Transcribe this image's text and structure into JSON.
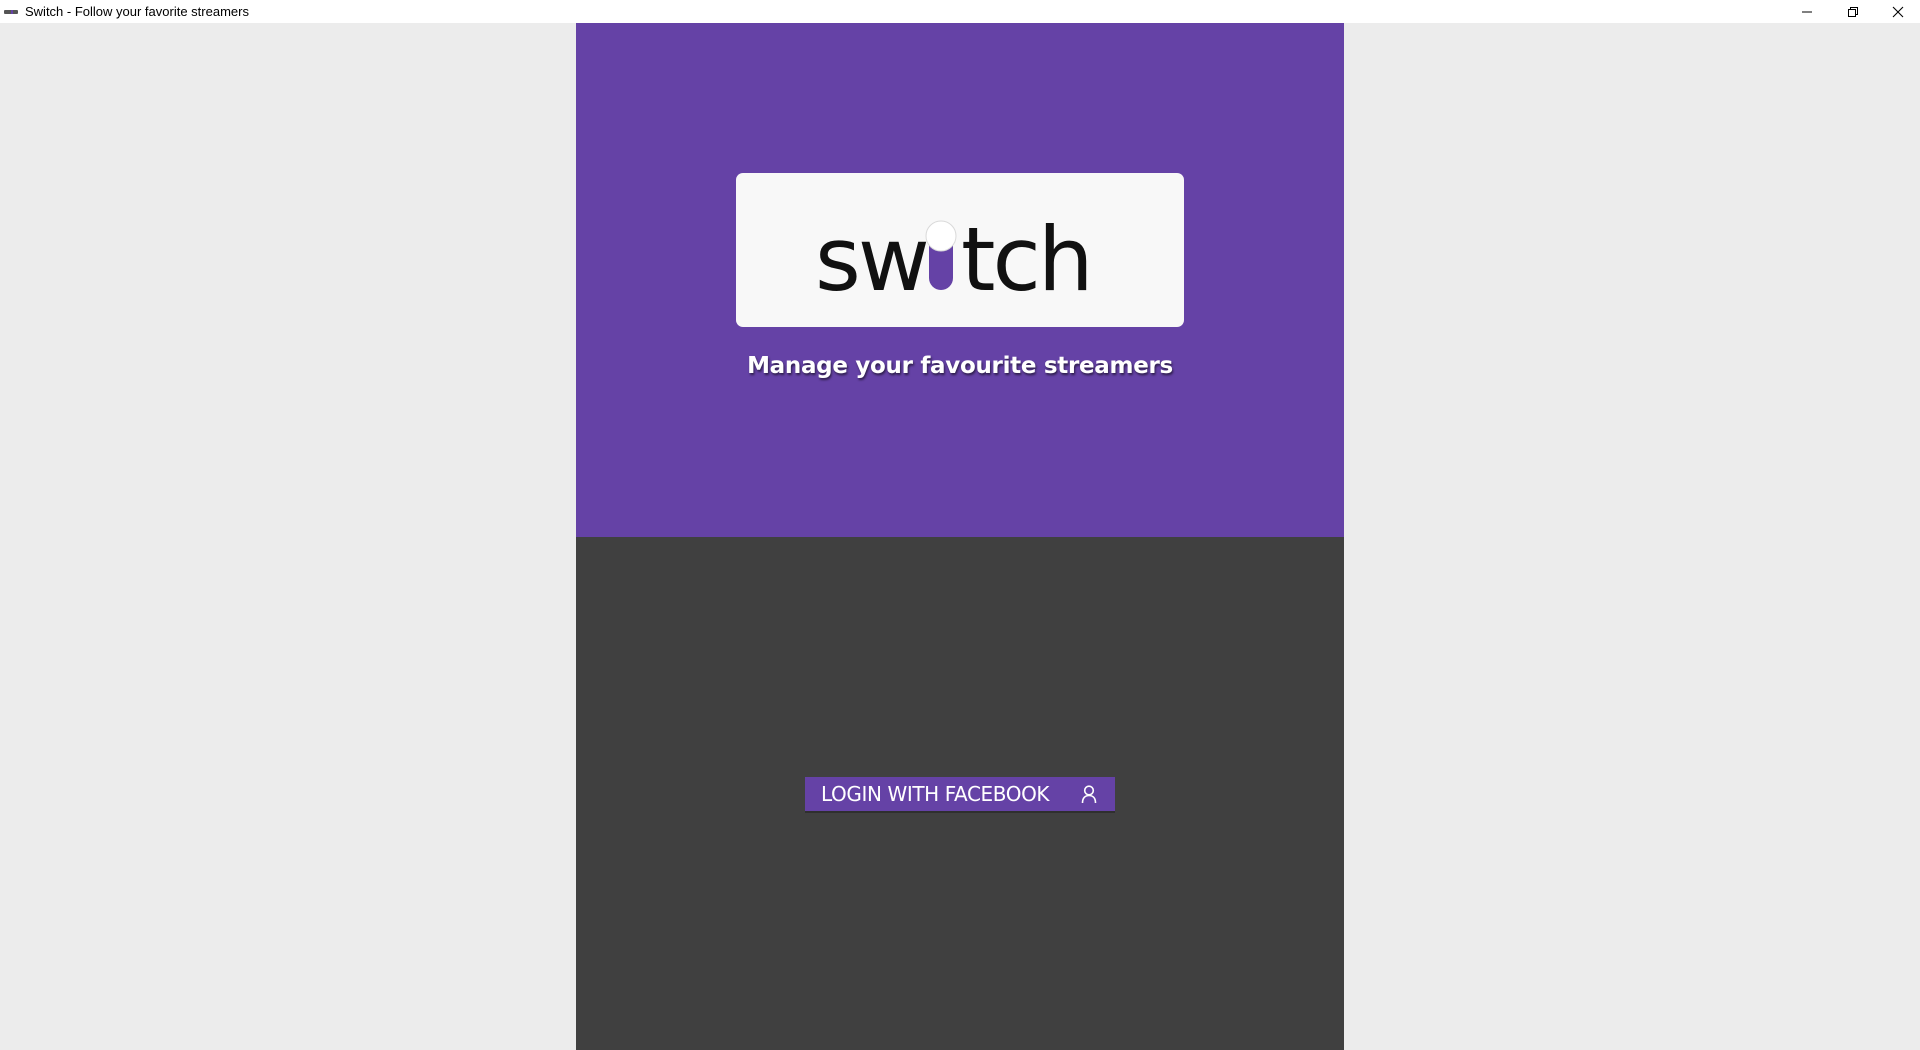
{
  "window": {
    "title": "Switch - Follow your favorite streamers",
    "icon": "switch-app-icon",
    "controls": {
      "minimize_icon": "minimize-icon",
      "restore_icon": "restore-icon",
      "close_icon": "close-icon"
    }
  },
  "colors": {
    "brand": "#6542a6",
    "dark": "#404040",
    "background": "#ececec",
    "logo_card": "#f8f8f8"
  },
  "hero": {
    "logo_text": "switch",
    "tagline": "Manage your favourite streamers"
  },
  "login": {
    "button_label": "LOGIN WITH FACEBOOK",
    "icon": "user-icon"
  }
}
